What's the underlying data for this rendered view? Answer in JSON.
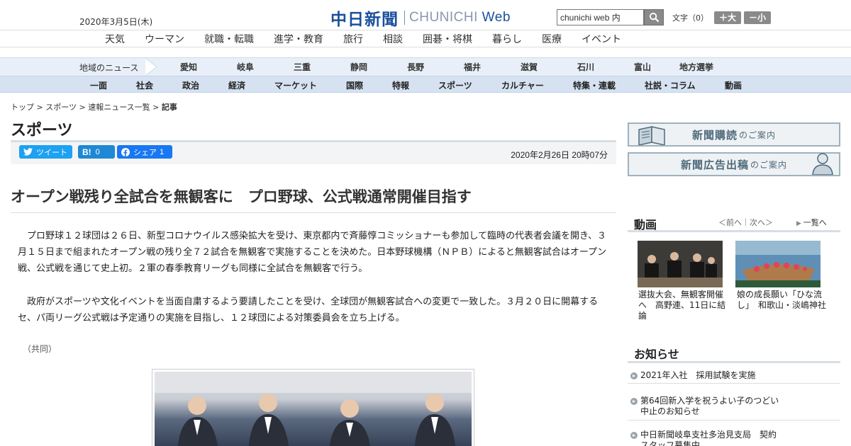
{
  "header": {
    "date": "2020年3月5日(木)",
    "logo_kanji": "中日新聞",
    "logo_en_main": "CHUNICHI",
    "logo_en_sub": "Web",
    "search_value": "chunichi web 内",
    "font_label": "文字（0）",
    "font_large": "＋大",
    "font_small": "－小"
  },
  "genre_nav": [
    "天気",
    "ウーマン",
    "就職・転職",
    "進学・教育",
    "旅行",
    "相談",
    "囲碁・将棋",
    "暮らし",
    "医療",
    "イベント"
  ],
  "local_nav": {
    "title": "地域のニュース",
    "items": [
      "愛知",
      "岐阜",
      "三重",
      "静岡",
      "長野",
      "福井",
      "滋賀",
      "石川",
      "富山",
      "地方選挙"
    ]
  },
  "section_nav": [
    "一面",
    "社会",
    "政治",
    "経済",
    "マーケット",
    "国際",
    "特報",
    "スポーツ",
    "カルチャー",
    "特集・連載",
    "社説・コラム",
    "動画"
  ],
  "breadcrumb": [
    "トップ",
    "スポーツ",
    "速報ニュース一覧",
    "記事"
  ],
  "breadcrumb_sep": " > ",
  "section_title": "スポーツ",
  "share": {
    "tweet": "ツイート",
    "hatena_label": "B!",
    "hatena_count": "0",
    "fb_label": "シェア",
    "fb_count": "1"
  },
  "post_date": "2020年2月26日 20時07分",
  "article": {
    "headline": "オープン戦残り全試合を無観客に　プロ野球、公式戦通常開催目指す",
    "paragraphs": [
      "プロ野球１２球団は２６日、新型コロナウイルス感染拡大を受け、東京都内で斉藤惇コミッショナーも参加して臨時の代表者会議を開き、３月１５日まで組まれたオープン戦の残り全７２試合を無観客で実施することを決めた。日本野球機構（ＮＰＢ）によると無観客試合はオープン戦、公式戦を通じて史上初。２軍の春季教育リーグも同様に全試合を無観客で行う。",
      "政府がスポーツや文化イベントを当面自粛するよう要請したことを受け、全球団が無観客試合への変更で一致した。３月２０日に開幕するセ、パ両リーグ公式戦は予定通りの実施を目指し、１２球団による対策委員会を立ち上げる。"
    ],
    "credit": "（共同）"
  },
  "sidebar": {
    "banner1_main": "新聞購読",
    "banner1_sub": "のご案内",
    "banner2_main": "新聞広告出稿",
    "banner2_sub": "のご案内",
    "video_title": "動画",
    "video_prevnext": "＜前へ｜次へ＞",
    "video_list": "一覧へ",
    "videos": [
      "選抜大会、無観客開催へ　高野連、11日に結論",
      "娘の成長願い「ひな流し」　和歌山・淡嶋神社"
    ],
    "notice_title": "お知らせ",
    "notices": [
      "2021年入社　採用試験を実施",
      "第64回新入学を祝うよい子のつどい　中止のお知らせ",
      "中日新聞岐阜支社多治見支局　契約スタッフ募集中"
    ]
  },
  "colors": {
    "brand": "#1a4f9c",
    "twitter": "#1da1f2",
    "hatena": "#1e88d4",
    "facebook": "#1877f2"
  }
}
